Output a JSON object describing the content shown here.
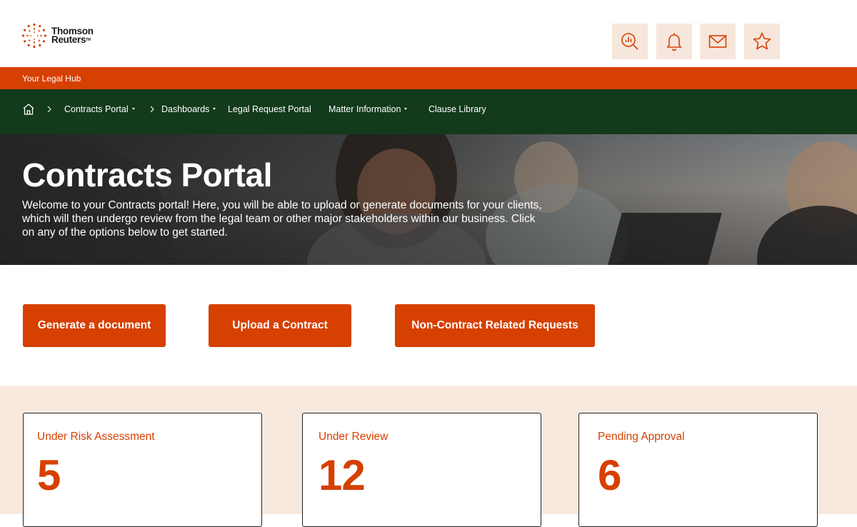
{
  "brand": {
    "name_line1": "Thomson",
    "name_line2": "Reuters",
    "tm": "TM",
    "accent": "#d64000",
    "nav_bg": "#123a1b",
    "icon_bg": "#f6e6dc"
  },
  "header": {
    "icons": [
      {
        "name": "analytics-search-icon"
      },
      {
        "name": "bell-icon"
      },
      {
        "name": "mail-icon"
      },
      {
        "name": "star-icon"
      }
    ]
  },
  "hub": {
    "label": "Your Legal Hub"
  },
  "nav": {
    "items": [
      {
        "label": "Contracts Portal",
        "dropdown": true
      },
      {
        "label": "Dashboards",
        "dropdown": true
      },
      {
        "label": "Legal Request Portal",
        "dropdown": false
      },
      {
        "label": "Matter Information",
        "dropdown": true
      },
      {
        "label": "Clause Library",
        "dropdown": false
      }
    ]
  },
  "hero": {
    "title": "Contracts Portal",
    "description": "Welcome to your Contracts portal! Here, you will be able to upload or generate documents for your clients, which will then undergo review from the legal team or other major stakeholders within our business. Click on any of the options below to get started."
  },
  "actions": [
    {
      "label": "Generate a document"
    },
    {
      "label": "Upload a Contract"
    },
    {
      "label": "Non-Contract Related Requests"
    }
  ],
  "stats": [
    {
      "label": "Under Risk Assessment",
      "value": "5"
    },
    {
      "label": "Under Review",
      "value": "12"
    },
    {
      "label": "Pending Approval",
      "value": "6"
    }
  ]
}
